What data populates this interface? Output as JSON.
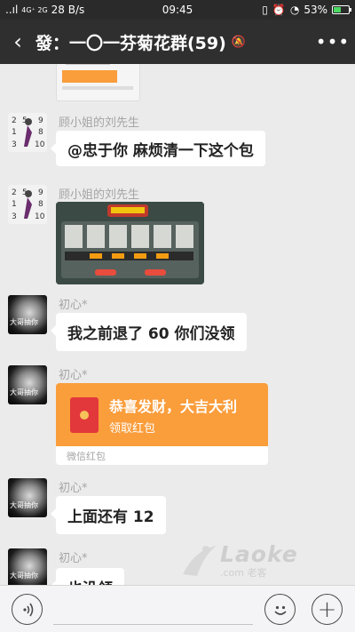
{
  "status_bar": {
    "signal": "..ıl",
    "network": "4G⁺ 2G",
    "speed": "28 B/s",
    "time": "09:45",
    "battery": "53%",
    "battery_level": 0.53
  },
  "header": {
    "title": "發：一〇一芬菊花群(59)"
  },
  "messages": [
    {
      "sender": "顾小姐的刘先生",
      "text": "@忠于你  麻烦清一下这个包"
    },
    {
      "sender": "顾小姐的刘先生",
      "image": "game-screenshot"
    },
    {
      "sender": "初心*",
      "avatar_text": "大哥抽你",
      "text": "我之前退了 60 你们没领"
    },
    {
      "sender": "初心*",
      "avatar_text": "大哥抽你",
      "redpacket": {
        "title": "恭喜发财，大吉大利",
        "action": "领取红包",
        "footer": "微信红包"
      }
    },
    {
      "sender": "初心*",
      "avatar_text": "大哥抽你",
      "text": "上面还有 12"
    },
    {
      "sender": "初心*",
      "avatar_text": "大哥抽你",
      "text": "也没领"
    }
  ],
  "watermark": {
    "logo": "Laoke",
    "sub": ".com 老客"
  },
  "colors": {
    "titlebar": "#2f2f2f",
    "chat_bg": "#ebebeb",
    "redpacket": "#fa9d3b"
  }
}
